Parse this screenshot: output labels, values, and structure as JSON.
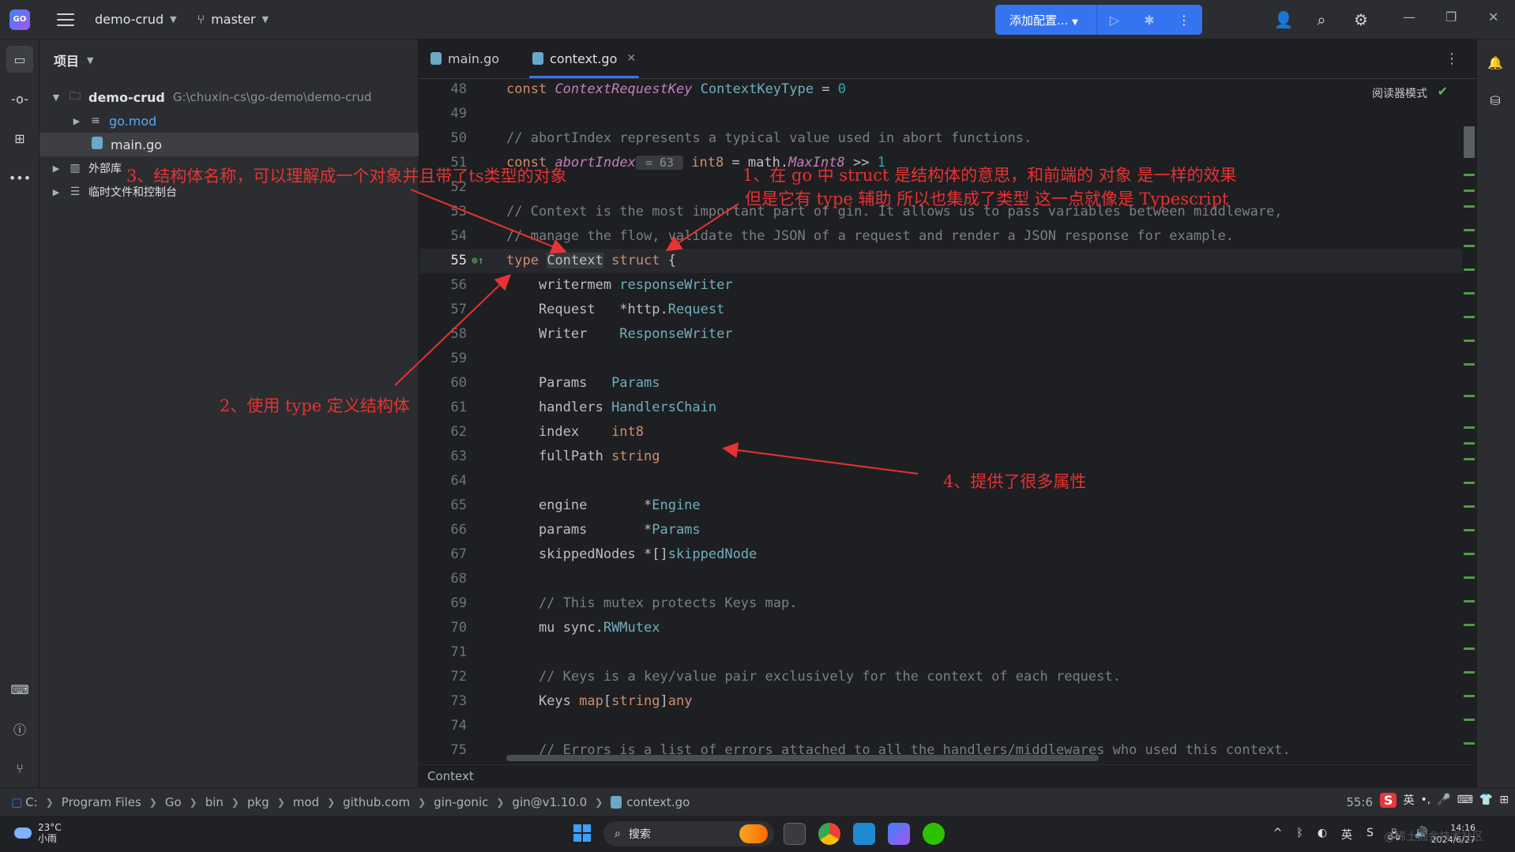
{
  "titlebar": {
    "project_name": "demo-crud",
    "branch": "master",
    "run_config_label": "添加配置..."
  },
  "project_panel": {
    "title": "项目",
    "tree": [
      {
        "label": "demo-crud",
        "path": "G:\\chuxin-cs\\go-demo\\demo-crud",
        "icon": "folder-icon",
        "expanded": true
      },
      {
        "label": "go.mod",
        "icon": "gomod-file-icon"
      },
      {
        "label": "main.go",
        "icon": "go-file-icon",
        "selected": true
      },
      {
        "label": "外部库",
        "icon": "library-icon"
      },
      {
        "label": "临时文件和控制台",
        "icon": "scratch-icon"
      }
    ]
  },
  "tabs": [
    {
      "label": "main.go",
      "active": false
    },
    {
      "label": "context.go",
      "active": true
    }
  ],
  "editor": {
    "reader_mode": "阅读器模式",
    "current_line": 55,
    "bottom_breadcrumb": "Context"
  },
  "annotations": {
    "a1_line1": "1、在 go 中 struct 是结构体的意思，和前端的 对象 是一样的效果",
    "a1_line2": "但是它有 type 辅助 所以也集成了类型 这一点就像是 Typescript",
    "a2": "2、使用 type 定义结构体",
    "a3": "3、结构体名称，可以理解成一个对象并且带了ts类型的对象",
    "a4": "4、提供了很多属性"
  },
  "statusbar": {
    "path": [
      "C:",
      "Program Files",
      "Go",
      "bin",
      "pkg",
      "mod",
      "github.com",
      "gin-gonic",
      "gin@v1.10.0",
      "context.go"
    ],
    "cursor": "55:6",
    "ime_lang": "英"
  },
  "taskbar": {
    "weather_temp": "23°C",
    "weather_desc": "小雨",
    "search_label": "搜索",
    "tray_lang": "英",
    "time": "14:16",
    "date": "2024/6/27",
    "watermark": "@稀土掘金技术社区"
  }
}
